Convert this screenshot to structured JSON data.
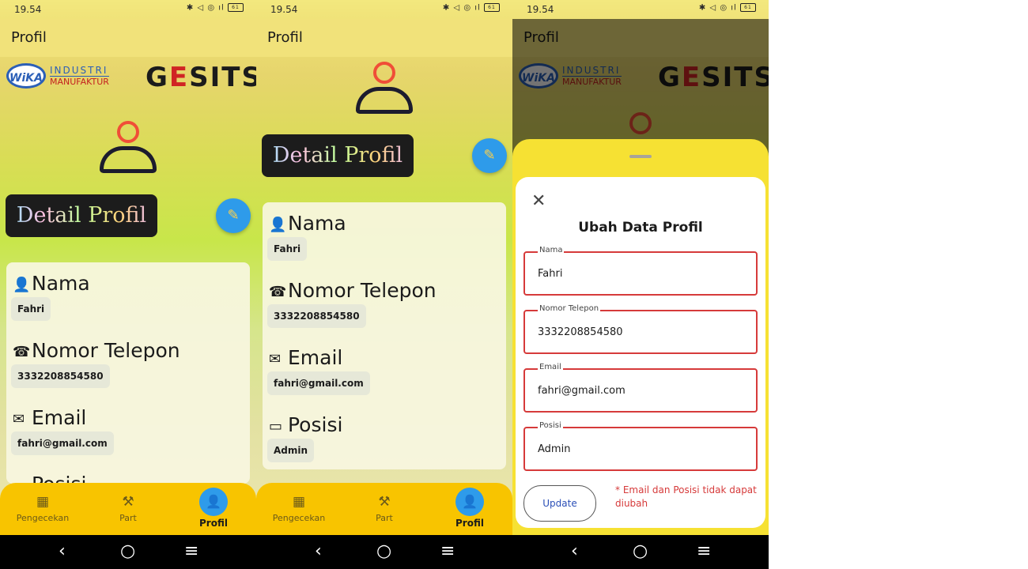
{
  "status": {
    "time": "19.54",
    "icons": "✱ ◁ ◎ ıl",
    "battery": "61"
  },
  "app": {
    "title": "Profil"
  },
  "logos": {
    "wika": "WiKA",
    "industri": "INDUSTRI",
    "manufaktur": "MANUFAKTUR",
    "gesits_g": "G",
    "gesits_e": "E",
    "gesits_rest": "SITS"
  },
  "detail_title": "Detail Profil",
  "profile": {
    "fields": [
      {
        "label": "Nama",
        "value": "Fahri",
        "icon": "person-icon"
      },
      {
        "label": "Nomor Telepon",
        "value": "3332208854580",
        "icon": "phone-icon"
      },
      {
        "label": "Email",
        "value": "fahri@gmail.com",
        "icon": "email-icon"
      },
      {
        "label": "Posisi",
        "value": "Admin",
        "icon": "monitor-icon"
      }
    ]
  },
  "nav": {
    "items": [
      {
        "label": "Pengecekan",
        "icon": "grid-icon"
      },
      {
        "label": "Part",
        "icon": "tools-icon"
      },
      {
        "label": "Profil",
        "icon": "person-icon"
      }
    ]
  },
  "form": {
    "title": "Ubah Data Profil",
    "fields": [
      {
        "label": "Nama",
        "value": "Fahri"
      },
      {
        "label": "Nomor Telepon",
        "value": "3332208854580"
      },
      {
        "label": "Email",
        "value": "fahri@gmail.com"
      },
      {
        "label": "Posisi",
        "value": "Admin"
      }
    ],
    "update_label": "Update",
    "note": "* Email dan Posisi tidak dapat diubah"
  },
  "colors": {
    "accent": "#2e9bea",
    "navbar": "#f8c400",
    "sheet": "#f6e133",
    "error": "#d63a3a"
  }
}
